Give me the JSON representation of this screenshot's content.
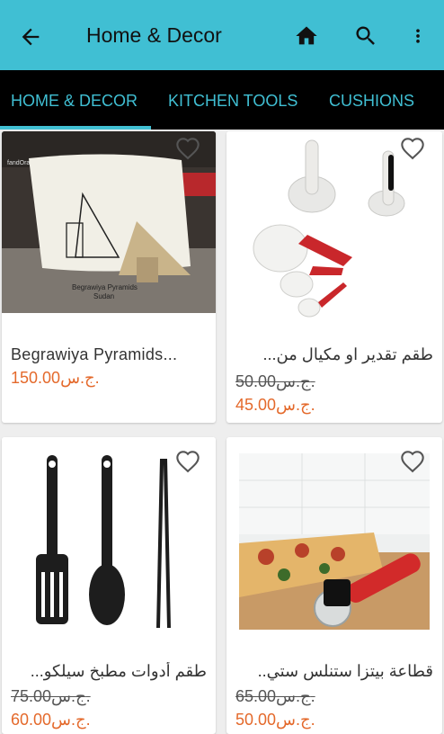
{
  "appbar": {
    "title": "Home & Decor",
    "background": "#40bfd3",
    "icons": [
      "back-arrow-icon",
      "home-icon",
      "search-icon",
      "more-vert-icon"
    ]
  },
  "tabs": [
    {
      "label": "HOME & DECOR",
      "active": true
    },
    {
      "label": "KITCHEN TOOLS",
      "active": false
    },
    {
      "label": "CUSHIONS",
      "active": false
    }
  ],
  "colors": {
    "accent": "#40bfd3",
    "price": "#e4692b",
    "tabbar": "#000000"
  },
  "products": [
    {
      "name": "Begrawiya Pyramids...",
      "old_price": "",
      "price": "150.00ج.س.",
      "image_text": [
        "fandOra",
        "Begrawiya Pyramids",
        "Sudan"
      ]
    },
    {
      "name": "طقم تقدير او مكيال من...",
      "old_price": "50.00ج.س.",
      "price": "45.00ج.س."
    },
    {
      "name": "طقم أدوات مطبخ سيلكو...",
      "old_price": "75.00ج.س.",
      "price": "60.00ج.س."
    },
    {
      "name": "قطاعة بيتزا ستنلس ستي..",
      "old_price": "65.00ج.س.",
      "price": "50.00ج.س."
    }
  ]
}
